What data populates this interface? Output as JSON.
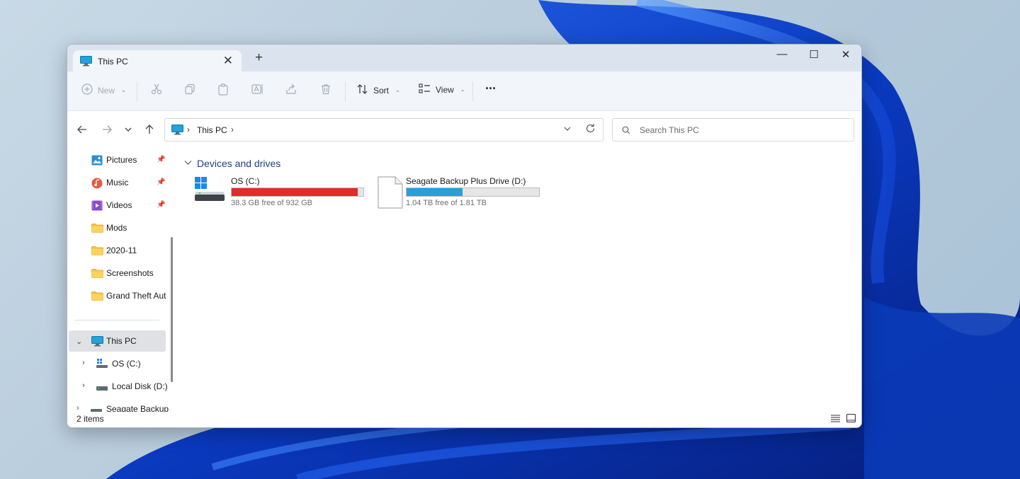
{
  "window": {
    "tab_title": "This PC",
    "new_tab_glyph": "+",
    "close_tab_glyph": "✕",
    "minimize_glyph": "—",
    "maximize_glyph": "☐",
    "close_glyph": "✕"
  },
  "toolbar": {
    "new_label": "New",
    "sort_label": "Sort",
    "view_label": "View",
    "more_glyph": "···"
  },
  "address": {
    "path": "This PC",
    "search_placeholder": "Search This PC"
  },
  "sidebar": {
    "items": [
      {
        "label": "Pictures",
        "icon": "pictures-icon",
        "pinned": true
      },
      {
        "label": "Music",
        "icon": "music-icon",
        "pinned": true
      },
      {
        "label": "Videos",
        "icon": "videos-icon",
        "pinned": true
      },
      {
        "label": "Mods",
        "icon": "folder-icon",
        "pinned": false
      },
      {
        "label": "2020-11",
        "icon": "folder-icon",
        "pinned": false
      },
      {
        "label": "Screenshots",
        "icon": "folder-icon",
        "pinned": false
      },
      {
        "label": "Grand Theft Aut",
        "icon": "folder-icon",
        "pinned": false
      }
    ],
    "tree": [
      {
        "label": "This PC",
        "icon": "pc-icon",
        "expanded": true,
        "selected": true
      },
      {
        "label": "OS (C:)",
        "icon": "windows-drive-icon"
      },
      {
        "label": "Local Disk (D:)",
        "icon": "drive-icon"
      },
      {
        "label": "Seagate Backup",
        "icon": "drive-icon"
      }
    ]
  },
  "content": {
    "group_title": "Devices and drives",
    "drives": [
      {
        "name": "OS (C:)",
        "free_text": "38.3 GB free of 932 GB",
        "used_fraction": 0.959,
        "bar_color": "#e22b2b"
      },
      {
        "name": "Seagate Backup Plus Drive (D:)",
        "free_text": "1.04 TB free of 1.81 TB",
        "used_fraction": 0.425,
        "bar_color": "#26a0da"
      }
    ]
  },
  "status": {
    "item_count": "2 items"
  },
  "colors": {
    "accent": "#0067c0",
    "group_title": "#1f3f8a"
  }
}
